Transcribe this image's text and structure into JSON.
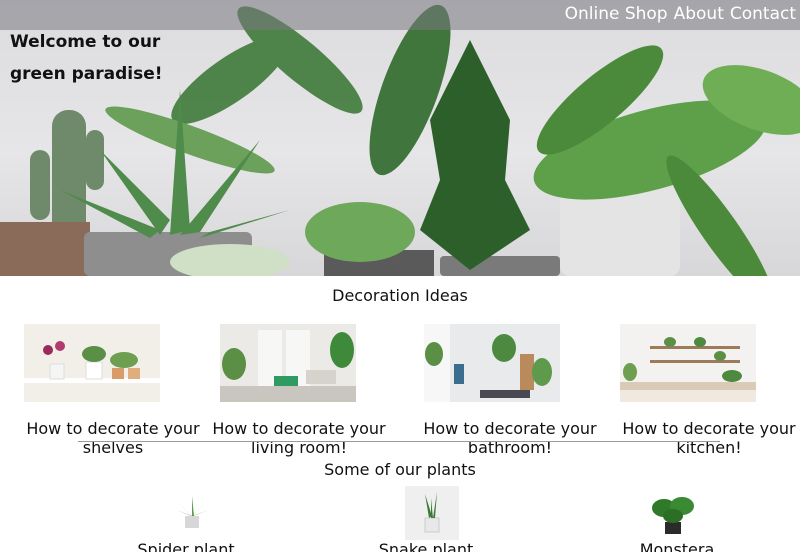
{
  "nav": {
    "items": [
      "Online Shop",
      "About",
      "Contact"
    ]
  },
  "hero": {
    "welcome_line1": "Welcome to our",
    "welcome_line2": "green paradise!"
  },
  "decoration": {
    "title": "Decoration Ideas",
    "cards": [
      {
        "caption": "How to decorate your shelves"
      },
      {
        "caption": "How to decorate your living room!"
      },
      {
        "caption": "How to decorate your bathroom!"
      },
      {
        "caption": "How to decorate your kitchen!"
      }
    ]
  },
  "plants": {
    "title": "Some of our plants",
    "items": [
      {
        "name": "Spider plant"
      },
      {
        "name": "Snake plant"
      },
      {
        "name": "Monstera"
      }
    ]
  }
}
